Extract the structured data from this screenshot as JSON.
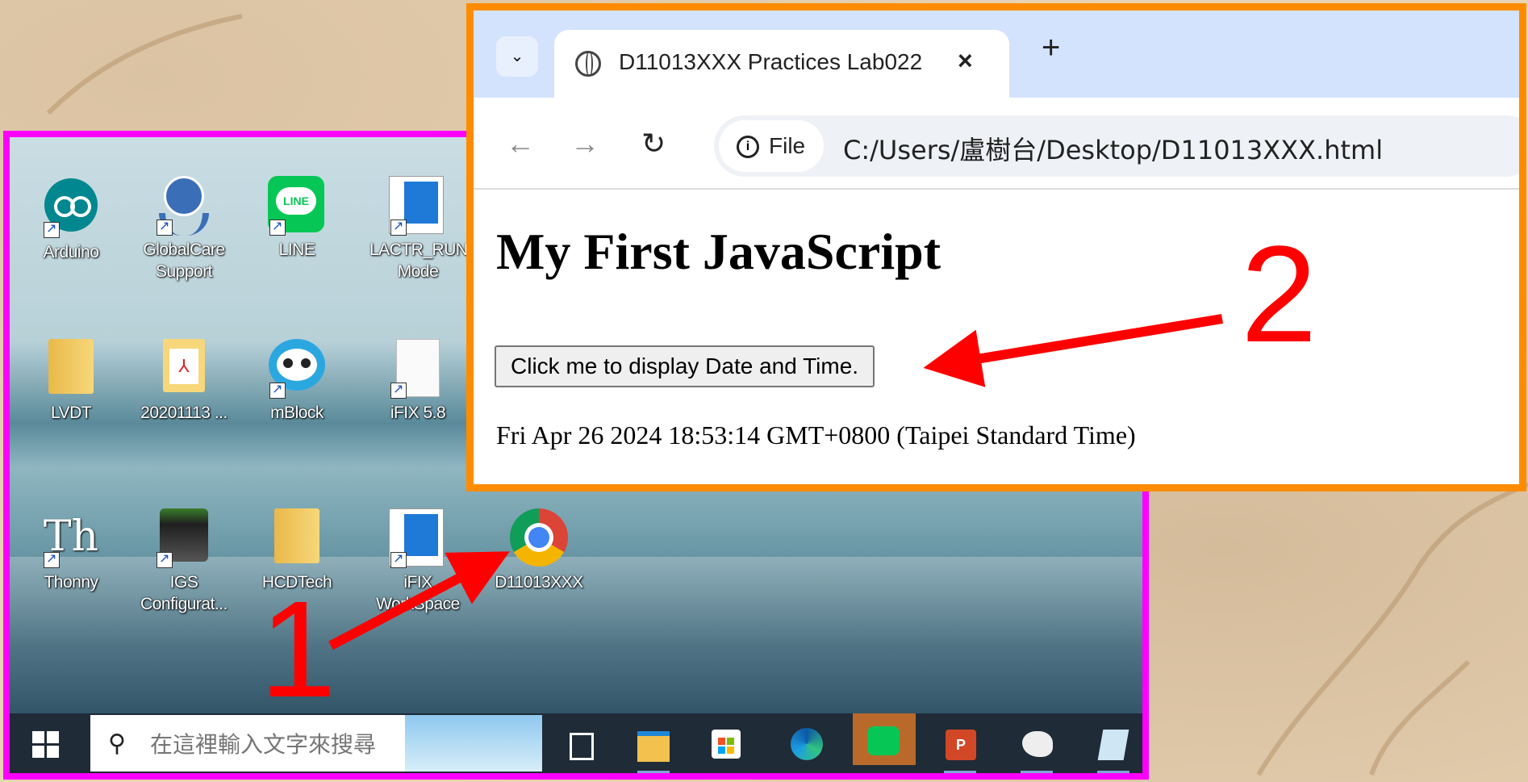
{
  "desktop": {
    "icons": [
      {
        "label": "Arduino",
        "icon": "arduino-icon"
      },
      {
        "label": "GlobalCare\nSupport",
        "icon": "globalcare-icon"
      },
      {
        "label": "LINE",
        "icon": "line-icon"
      },
      {
        "label": "LACTR_RUN\nMode",
        "icon": "window-app-icon"
      },
      {
        "label": "LVDT",
        "icon": "folder-icon"
      },
      {
        "label": "20201113 ...",
        "icon": "pdf-icon"
      },
      {
        "label": "mBlock",
        "icon": "mblock-panda-icon"
      },
      {
        "label": "iFIX 5.8",
        "icon": "blank-file-icon"
      },
      {
        "label": "Thonny",
        "icon": "thonny-icon"
      },
      {
        "label": "IGS\nConfigurat...",
        "icon": "igs-icon"
      },
      {
        "label": "HCDTech",
        "icon": "folder-icon"
      },
      {
        "label": "iFIX\nWorkSpace",
        "icon": "window-app-icon"
      },
      {
        "label": "D11013XXX",
        "icon": "chrome-icon"
      }
    ]
  },
  "taskbar": {
    "search_placeholder": "在這裡輸入文字來搜尋"
  },
  "browser": {
    "tab_title": "D11013XXX Practices Lab022",
    "close_glyph": "×",
    "new_tab_glyph": "+",
    "scheme_chip": "File",
    "url": "C:/Users/盧樹台/Desktop/D11013XXX.html"
  },
  "page": {
    "heading": "My First JavaScript",
    "button_label": "Click me to display Date and Time.",
    "datetime": "Fri Apr 26 2024 18:53:14 GMT+0800 (Taipei Standard Time)"
  },
  "annotations": {
    "step1": "1",
    "step2": "2"
  },
  "colors": {
    "desktop_frame": "#ff00ff",
    "browser_frame": "#ff8c00",
    "annotation": "#ff0000"
  }
}
